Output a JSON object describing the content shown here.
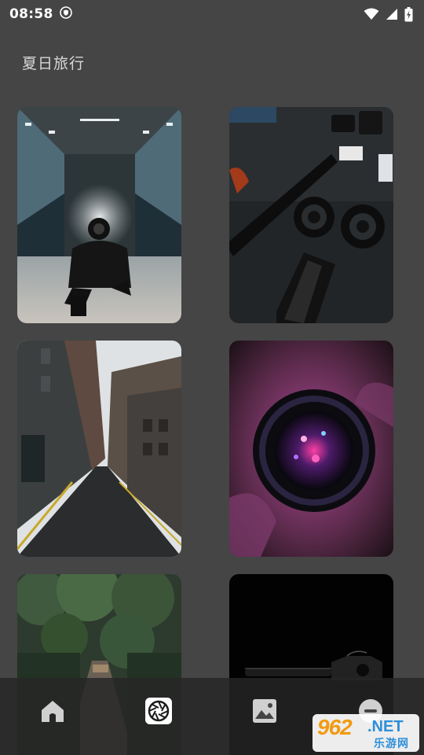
{
  "status_bar": {
    "time": "08:58",
    "icons": [
      "shield-icon",
      "wifi-icon",
      "signal-icon",
      "battery-charging-icon"
    ]
  },
  "page": {
    "title": "夏日旅行"
  },
  "gallery": {
    "photos": [
      {
        "subject": "person-smoke-camera-station"
      },
      {
        "subject": "camera-lenses-table"
      },
      {
        "subject": "city-alley"
      },
      {
        "subject": "lens-purple-light"
      },
      {
        "subject": "forest-road"
      },
      {
        "subject": "camera-dark"
      }
    ]
  },
  "bottom_nav": {
    "items": [
      {
        "icon": "home-icon",
        "active": false
      },
      {
        "icon": "camera-shutter-icon",
        "active": true
      },
      {
        "icon": "image-icon",
        "active": false
      },
      {
        "icon": "profile-icon",
        "active": false
      }
    ]
  },
  "watermark": {
    "number": "962",
    "domain": ".NET",
    "subtitle": "乐游网"
  },
  "colors": {
    "background": "#454545",
    "nav_background": "#262626",
    "watermark_orange": "#f29a12",
    "watermark_blue": "#2d8fd8"
  }
}
